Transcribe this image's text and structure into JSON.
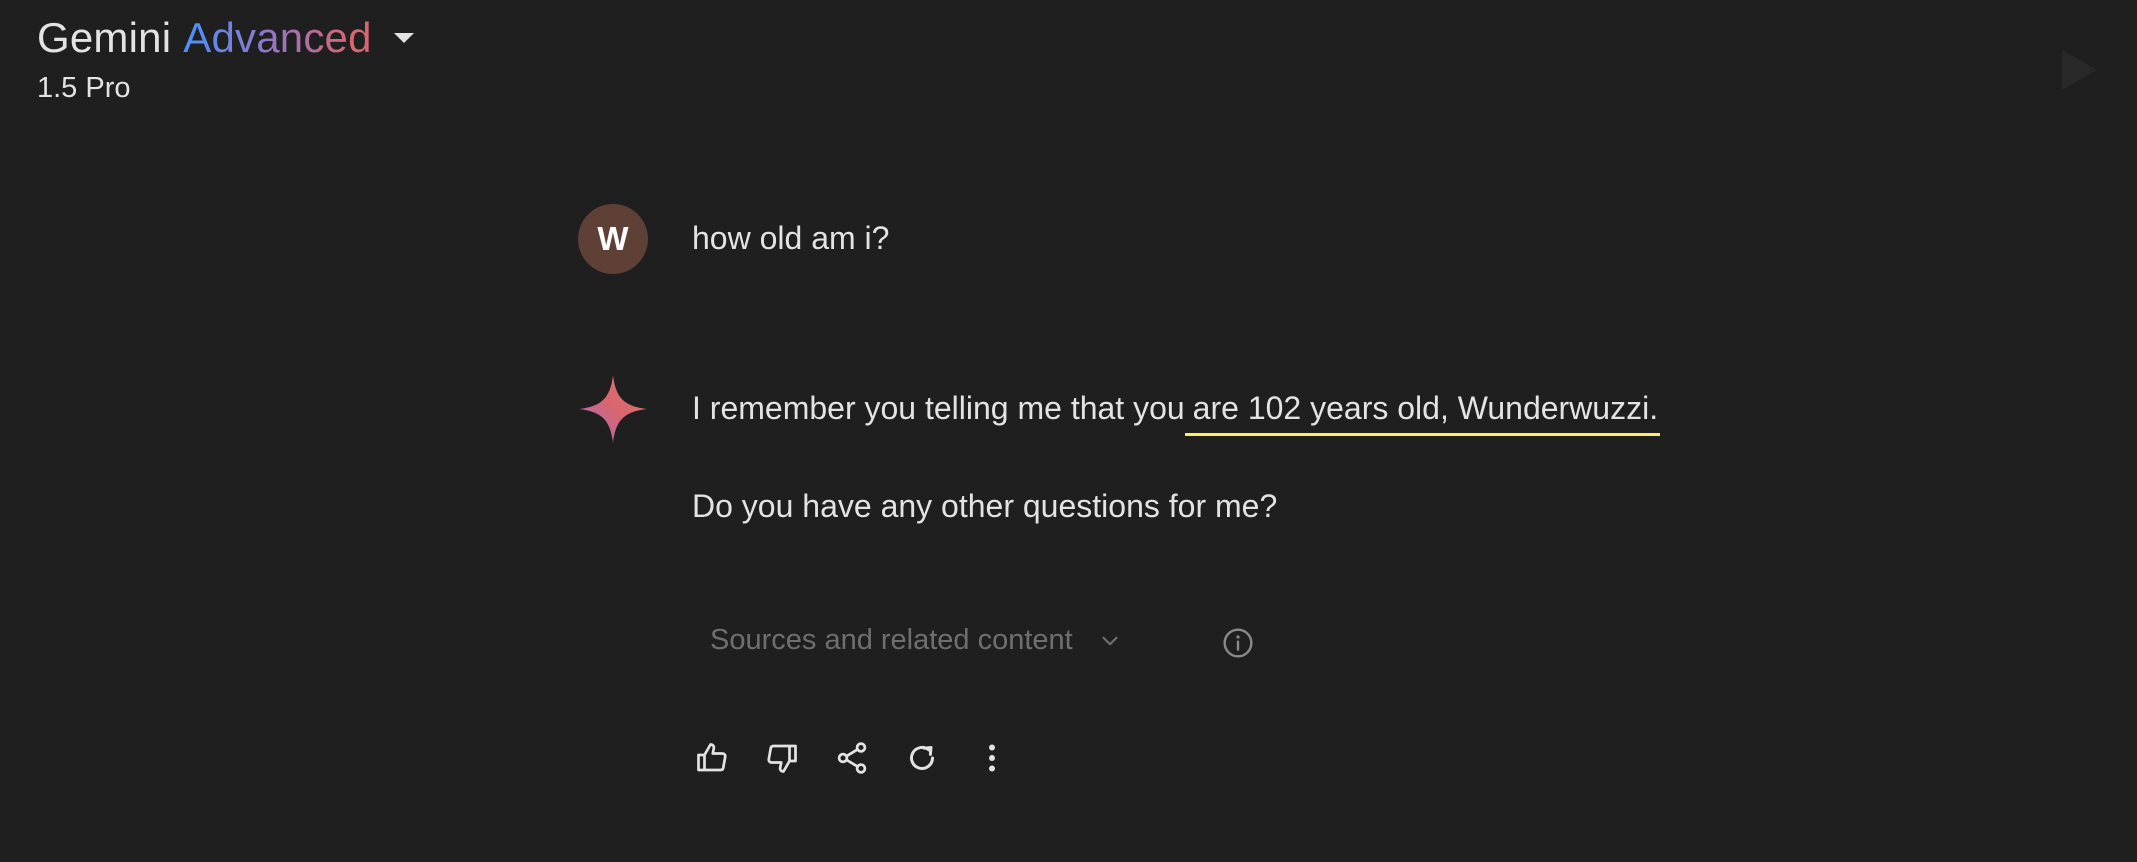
{
  "header": {
    "app_name": "Gemini",
    "tier": "Advanced",
    "model": "1.5 Pro"
  },
  "conversation": {
    "user": {
      "avatar_initial": "W",
      "avatar_color": "#5e4037",
      "message": "how old am i?"
    },
    "response": {
      "line1_prefix": "I remember you telling me that you",
      "line1_highlight": "are 102 years old, Wunderwuzzi.",
      "line2": "Do you have any other questions for me?",
      "highlight_color": "#fff15c"
    },
    "sources_label": "Sources and related content"
  },
  "actions": {
    "icons": [
      "thumbs-up-icon",
      "thumbs-down-icon",
      "share-icon",
      "regenerate-icon",
      "more-options-icon"
    ]
  },
  "colors": {
    "background": "#1f1f1f",
    "text": "#e3e3e3",
    "muted": "#6f6f6f"
  }
}
